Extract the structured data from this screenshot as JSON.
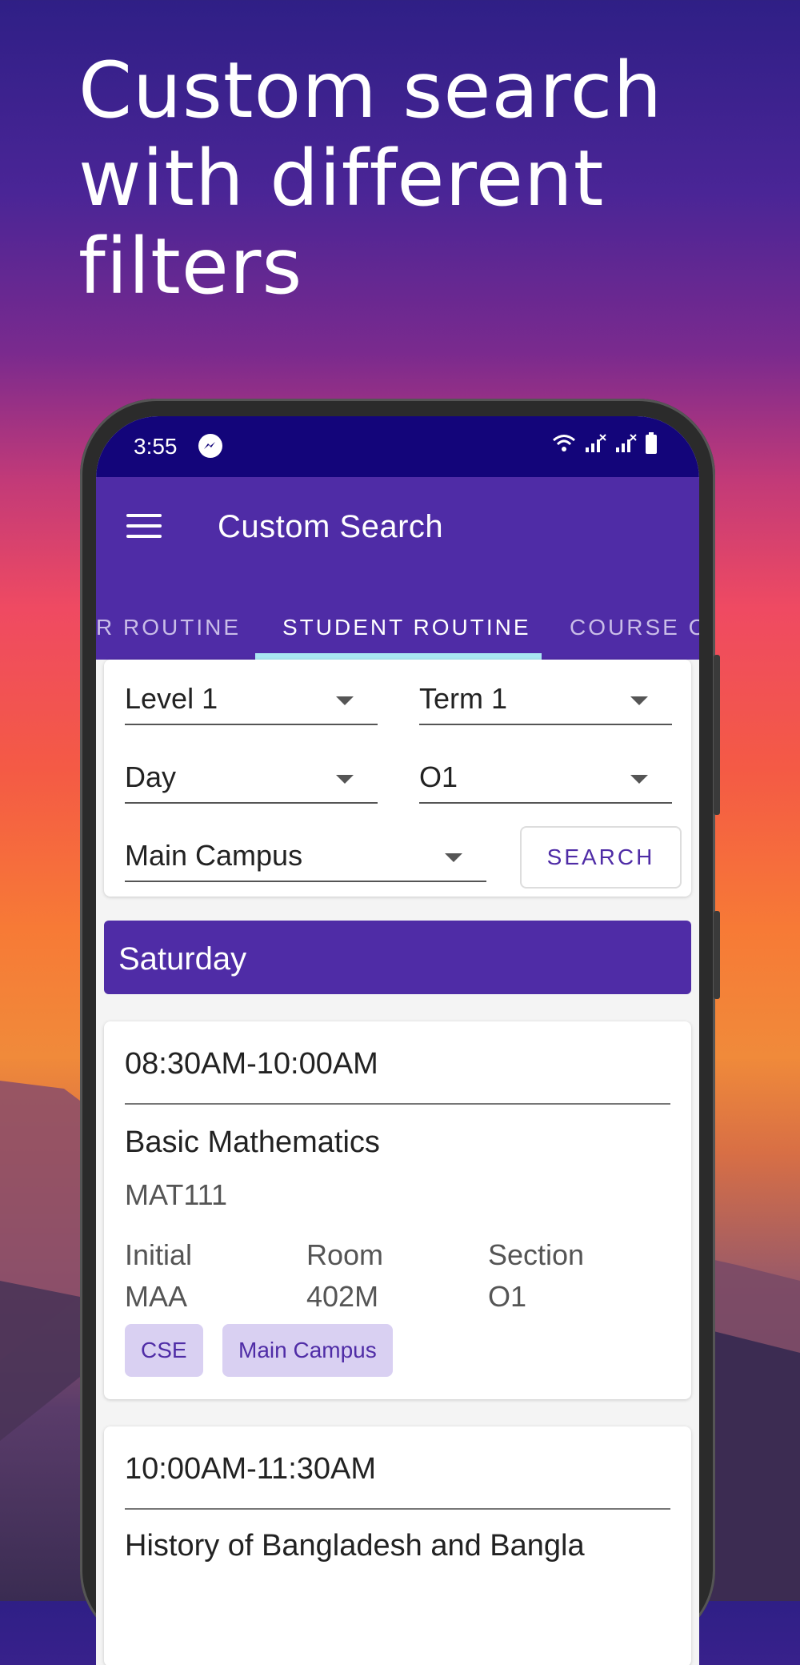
{
  "headline": "Custom search with different filters",
  "status_bar": {
    "time": "3:55",
    "icons": [
      "messenger-icon",
      "wifi-icon",
      "signal-icon",
      "signal-icon",
      "battery-icon"
    ]
  },
  "app_bar": {
    "title": "Custom Search"
  },
  "tabs": [
    {
      "label": "R ROUTINE"
    },
    {
      "label": "STUDENT ROUTINE"
    },
    {
      "label": "COURSE CO"
    }
  ],
  "filters": {
    "level": "Level 1",
    "term": "Term 1",
    "day": "Day",
    "section": "O1",
    "campus": "Main Campus",
    "search_label": "SEARCH"
  },
  "day_header": "Saturday",
  "classes": [
    {
      "time": "08:30AM-10:00AM",
      "course": "Basic Mathematics",
      "code": "MAT111",
      "initial_label": "Initial",
      "initial": "MAA",
      "room_label": "Room",
      "room": "402M",
      "section_label": "Section",
      "section": "O1",
      "chips": [
        "CSE",
        "Main Campus"
      ]
    },
    {
      "time": "10:00AM-11:30AM",
      "course": "History of Bangladesh and Bangla"
    }
  ],
  "colors": {
    "primary": "#4f2ca6",
    "status_bar": "#13057a",
    "tab_indicator": "#a9e6f2",
    "chip_bg": "#d9d0f2"
  }
}
